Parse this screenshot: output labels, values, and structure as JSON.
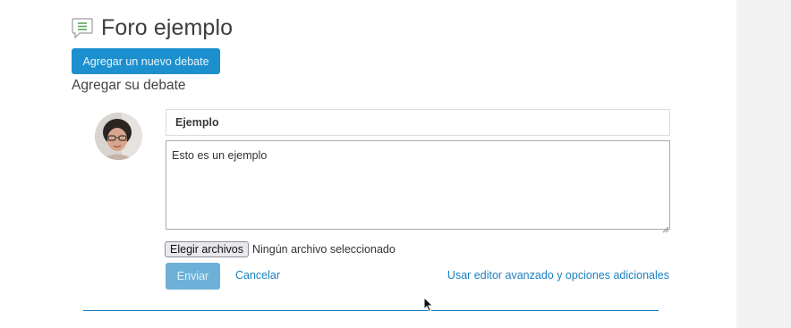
{
  "forum": {
    "title": "Foro ejemplo",
    "icon": "forum-speech-bubble-icon",
    "add_discussion_button": "Agregar un nuevo debate"
  },
  "form": {
    "heading": "Agregar su debate",
    "subject_value": "Ejemplo",
    "message_value": "Esto es un ejemplo",
    "file_button_label": "Elegir archivos",
    "file_status": "Ningún archivo seleccionado",
    "submit_label": "Enviar",
    "cancel_label": "Cancelar",
    "advanced_label": "Usar editor avanzado y opciones adicionales"
  },
  "colors": {
    "primary": "#1c90ce",
    "primary_disabled": "#6db1d8",
    "link": "#1a7fc0",
    "icon_green": "#5aa55a"
  }
}
